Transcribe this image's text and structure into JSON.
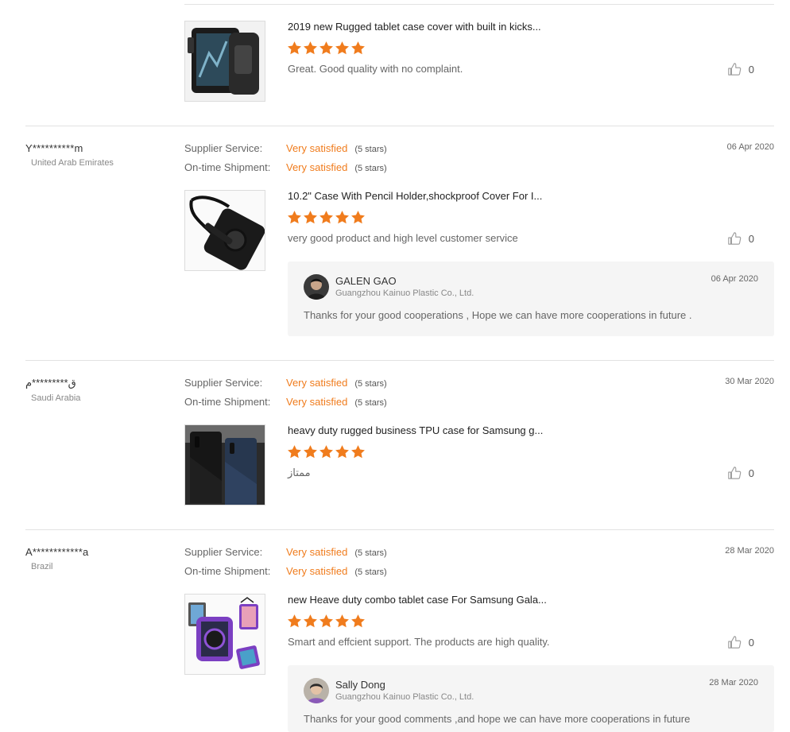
{
  "labels": {
    "supplier_service": "Supplier Service:",
    "ontime_shipment": "On-time Shipment:"
  },
  "reviews": [
    {
      "product_title": "2019 new Rugged tablet case cover with built in kicks...",
      "stars": 5,
      "comment": "Great. Good quality with no complaint.",
      "likes": "0"
    },
    {
      "buyer": "Y**********m",
      "country": "United Arab Emirates",
      "date": "06 Apr 2020",
      "supplier_service": "Very satisfied",
      "supplier_service_stars": "(5 stars)",
      "ontime_shipment": "Very satisfied",
      "ontime_shipment_stars": "(5 stars)",
      "product_title": "10.2\" Case With Pencil Holder,shockproof Cover For I...",
      "stars": 5,
      "comment": "very good product and high level customer service",
      "likes": "0",
      "reply": {
        "name": "GALEN GAO",
        "company": "Guangzhou Kainuo Plastic Co., Ltd.",
        "date": "06 Apr 2020",
        "text": "Thanks for your good cooperations ,  Hope we can have more cooperations in future ."
      }
    },
    {
      "buyer": "ق*********م",
      "country": "Saudi Arabia",
      "date": "30 Mar 2020",
      "supplier_service": "Very satisfied",
      "supplier_service_stars": "(5 stars)",
      "ontime_shipment": "Very satisfied",
      "ontime_shipment_stars": "(5 stars)",
      "product_title": "heavy duty rugged business TPU case for Samsung g...",
      "stars": 5,
      "comment": "ممتاز",
      "likes": "0"
    },
    {
      "buyer": "A************a",
      "country": "Brazil",
      "date": "28 Mar 2020",
      "supplier_service": "Very satisfied",
      "supplier_service_stars": "(5 stars)",
      "ontime_shipment": "Very satisfied",
      "ontime_shipment_stars": "(5 stars)",
      "product_title": "new Heave duty combo tablet case For Samsung Gala...",
      "stars": 5,
      "comment": "Smart and effcient support. The products are high quality.",
      "likes": "0",
      "reply": {
        "name": "Sally Dong",
        "company": "Guangzhou Kainuo Plastic Co., Ltd.",
        "date": "28 Mar 2020",
        "text": "Thanks for your good comments ,and hope we can have more cooperations in future"
      }
    }
  ],
  "colors": {
    "accent": "#f07c1d",
    "star": "#f07c1d",
    "divider": "#e2e2e2",
    "reply_bg": "#f5f5f5"
  },
  "icons": {
    "star": "star-icon",
    "like": "thumbs-up-icon"
  }
}
